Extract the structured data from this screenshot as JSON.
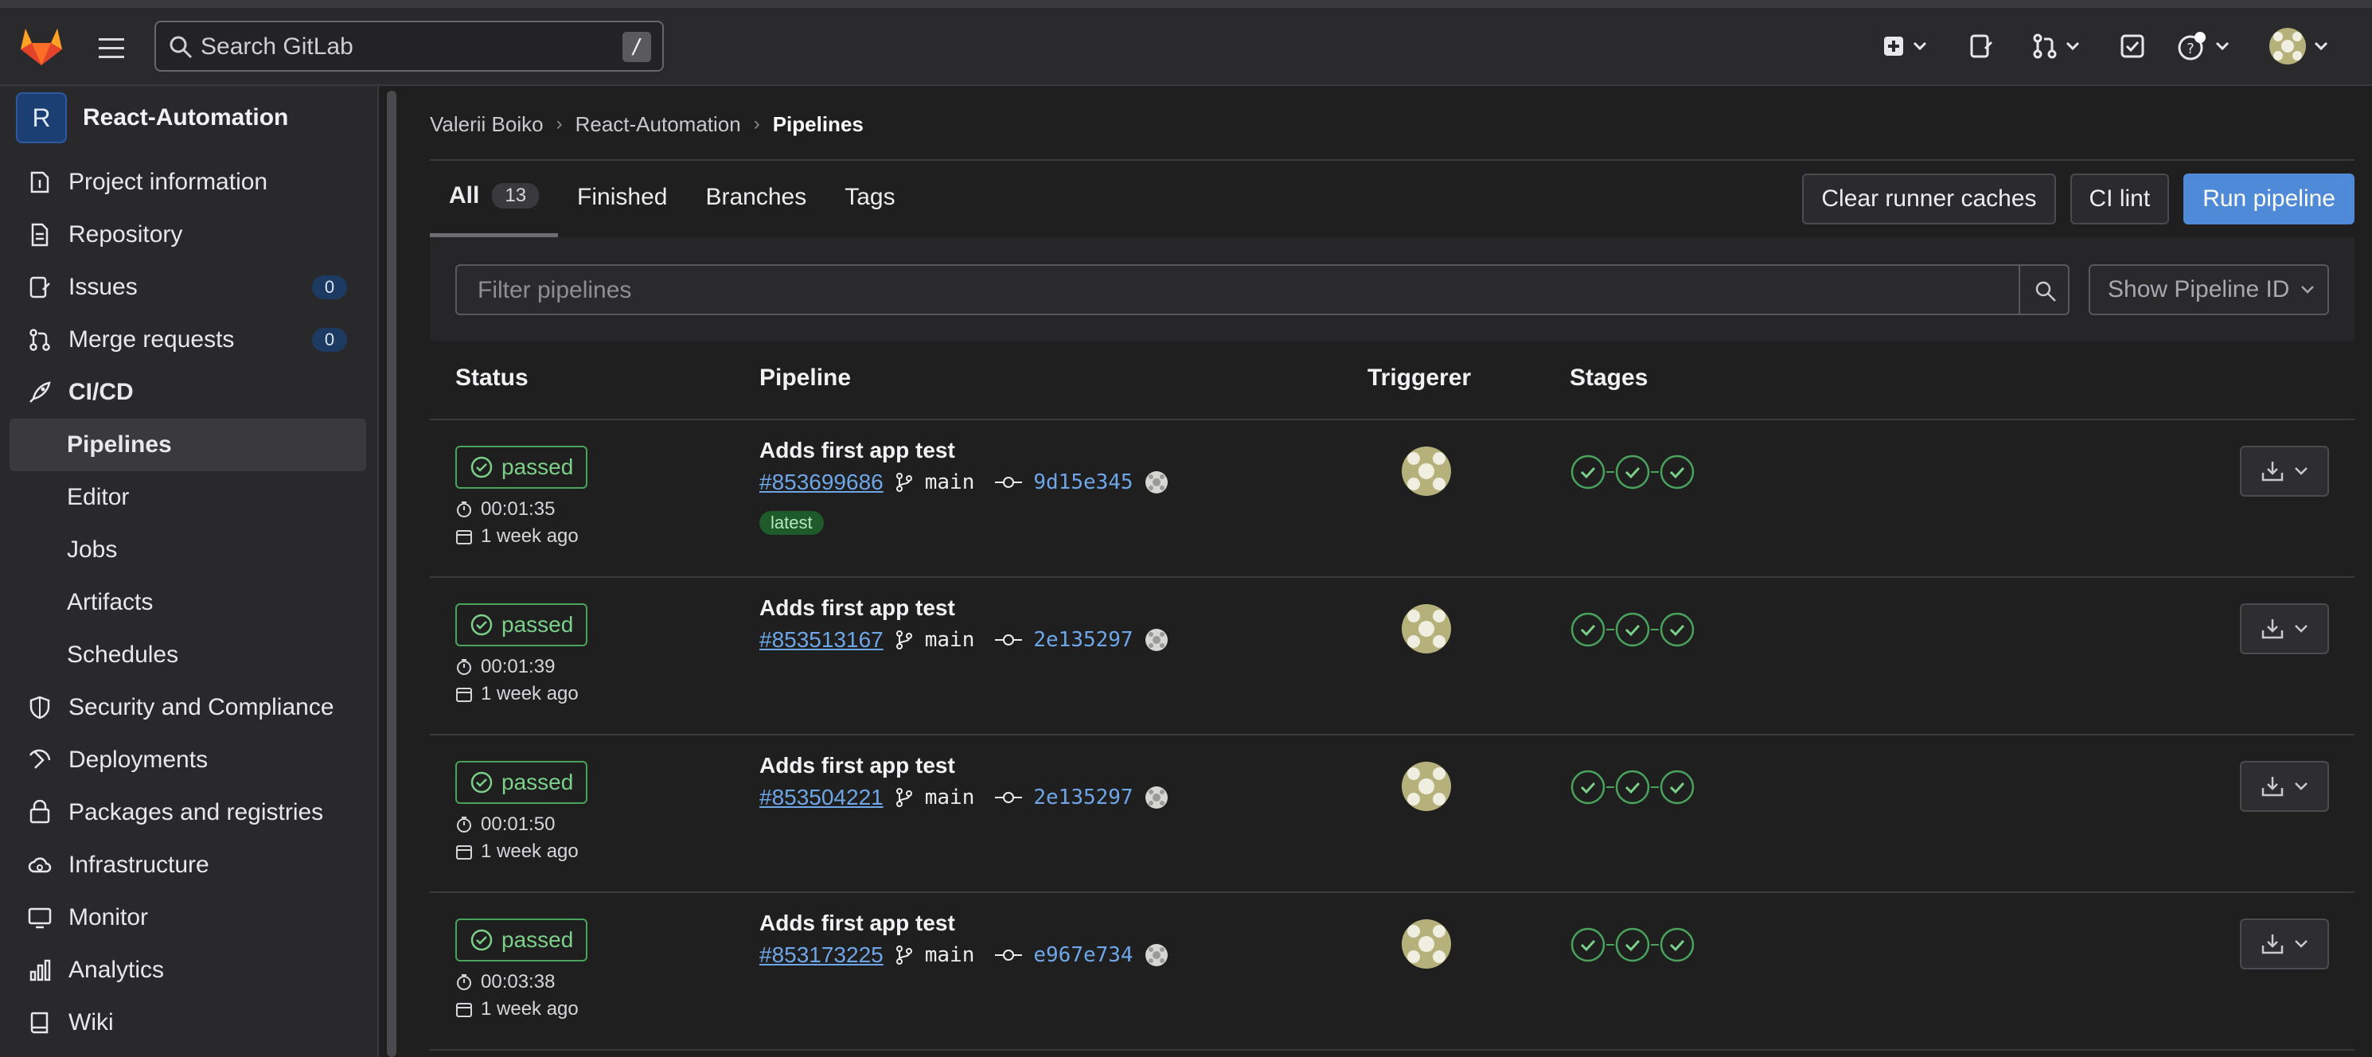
{
  "topbar": {
    "search_placeholder": "Search GitLab",
    "search_shortcut": "/",
    "icons": [
      "gitlab-logo",
      "hamburger",
      "plus-square",
      "issues",
      "merge-request",
      "todo",
      "help",
      "avatar"
    ]
  },
  "sidebar": {
    "project_initial": "R",
    "project_name": "React-Automation",
    "items": [
      {
        "label": "Project information",
        "icon": "info-icon"
      },
      {
        "label": "Repository",
        "icon": "doc-icon"
      },
      {
        "label": "Issues",
        "icon": "issues-icon",
        "count": "0"
      },
      {
        "label": "Merge requests",
        "icon": "merge-request-icon",
        "count": "0"
      },
      {
        "label": "CI/CD",
        "icon": "rocket-icon"
      },
      {
        "label": "Pipelines"
      },
      {
        "label": "Editor"
      },
      {
        "label": "Jobs"
      },
      {
        "label": "Artifacts"
      },
      {
        "label": "Schedules"
      },
      {
        "label": "Security and Compliance",
        "icon": "shield-icon"
      },
      {
        "label": "Deployments",
        "icon": "deploy-icon"
      },
      {
        "label": "Packages and registries",
        "icon": "package-icon"
      },
      {
        "label": "Infrastructure",
        "icon": "cloud-icon"
      },
      {
        "label": "Monitor",
        "icon": "monitor-icon"
      },
      {
        "label": "Analytics",
        "icon": "chart-icon"
      },
      {
        "label": "Wiki",
        "icon": "book-icon"
      }
    ]
  },
  "breadcrumb": {
    "items": [
      "Valerii Boiko",
      "React-Automation",
      "Pipelines"
    ]
  },
  "tabs": [
    {
      "label": "All",
      "count": "13"
    },
    {
      "label": "Finished"
    },
    {
      "label": "Branches"
    },
    {
      "label": "Tags"
    }
  ],
  "actions": {
    "clear_caches": "Clear runner caches",
    "ci_lint": "CI lint",
    "run_pipeline": "Run pipeline"
  },
  "filter": {
    "placeholder": "Filter pipelines",
    "select_value": "Show Pipeline ID"
  },
  "table": {
    "headers": {
      "status": "Status",
      "pipeline": "Pipeline",
      "triggerer": "Triggerer",
      "stages": "Stages"
    },
    "rows": [
      {
        "status": "passed",
        "duration": "00:01:35",
        "finished": "1 week ago",
        "title": "Adds first app test",
        "id": "#853699686",
        "branch": "main",
        "sha": "9d15e345",
        "tag": "latest"
      },
      {
        "status": "passed",
        "duration": "00:01:39",
        "finished": "1 week ago",
        "title": "Adds first app test",
        "id": "#853513167",
        "branch": "main",
        "sha": "2e135297"
      },
      {
        "status": "passed",
        "duration": "00:01:50",
        "finished": "1 week ago",
        "title": "Adds first app test",
        "id": "#853504221",
        "branch": "main",
        "sha": "2e135297"
      },
      {
        "status": "passed",
        "duration": "00:03:38",
        "finished": "1 week ago",
        "title": "Adds first app test",
        "id": "#853173225",
        "branch": "main",
        "sha": "e967e734"
      }
    ]
  },
  "colors": {
    "success": "#49a35c",
    "link": "#6ea6e8",
    "primary_button": "#4f8ad8"
  }
}
